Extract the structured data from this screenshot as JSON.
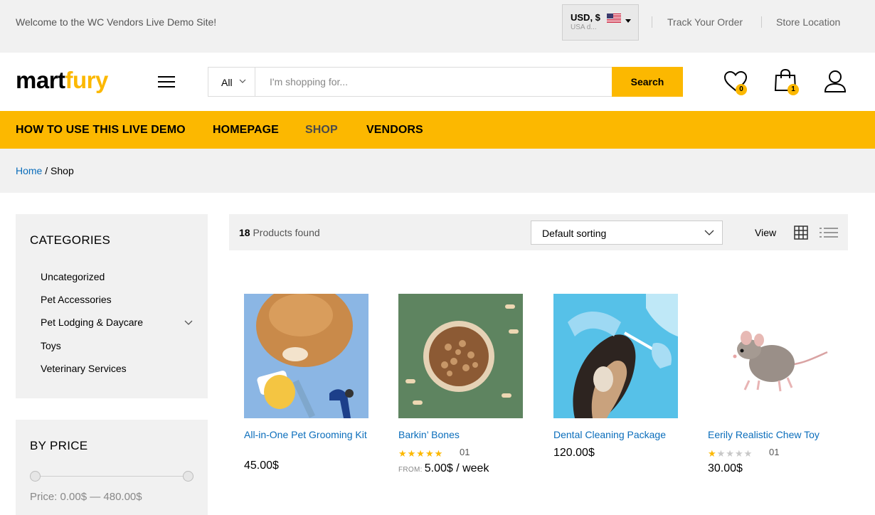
{
  "topbar": {
    "welcome": "Welcome to the WC Vendors Live Demo Site!",
    "currency_code": "USD, $",
    "currency_sub": "USA d...",
    "track_order": "Track Your Order",
    "store_location": "Store Location"
  },
  "header": {
    "logo_part1": "mart",
    "logo_part2": "fury",
    "search_category": "All",
    "search_placeholder": "I'm shopping for...",
    "search_button": "Search",
    "wishlist_count": "0",
    "cart_count": "1"
  },
  "nav": {
    "items": [
      "HOW TO USE THIS LIVE DEMO",
      "HOMEPAGE",
      "SHOP",
      "VENDORS"
    ],
    "active": "SHOP"
  },
  "breadcrumb": {
    "home": "Home",
    "separator": "/",
    "current": "Shop"
  },
  "sidebar": {
    "categories_title": "CATEGORIES",
    "categories": [
      "Uncategorized",
      "Pet Accessories",
      "Pet Lodging & Daycare",
      "Toys",
      "Veterinary Services"
    ],
    "price_title": "BY PRICE",
    "price_range": "Price: 0.00$ — 480.00$"
  },
  "toolbar": {
    "count": "18",
    "found_label": "Products found",
    "sort_value": "Default sorting",
    "view_label": "View"
  },
  "products": [
    {
      "name": "All-in-One Pet Grooming Kit",
      "price": "45.00$",
      "rating": null,
      "reviews": null
    },
    {
      "name": "Barkin’ Bones",
      "price_from": "FROM:",
      "price": "5.00$ / week",
      "rating": 5,
      "reviews": "01"
    },
    {
      "name": "Dental Cleaning Package",
      "price": "120.00$",
      "rating": null,
      "reviews": null
    },
    {
      "name": "Eerily Realistic Chew Toy",
      "price": "30.00$",
      "rating": 1,
      "reviews": "01"
    }
  ],
  "colors": {
    "accent": "#fcb800",
    "link": "#0a6dbb",
    "panel": "#f1f1f1",
    "star_on": "#fcb800",
    "star_off": "#c8c8c8"
  }
}
